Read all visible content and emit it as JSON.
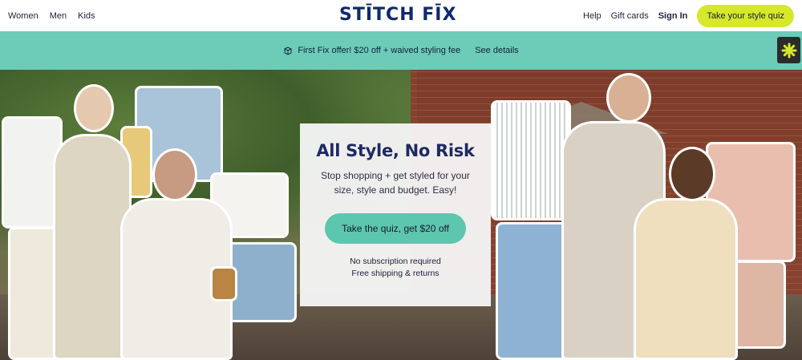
{
  "header": {
    "nav_left": [
      "Women",
      "Men",
      "Kids"
    ],
    "logo": "STĪTCH FĪX",
    "nav_right": {
      "help": "Help",
      "gift_cards": "Gift cards",
      "sign_in": "Sign In"
    },
    "quiz_button": "Take your style quiz"
  },
  "promo": {
    "icon": "gift-box-icon",
    "text": "First Fix offer! $20 off + waived styling fee",
    "details_link": "See details"
  },
  "chat": {
    "icon": "asterisk-chat-icon"
  },
  "hero": {
    "title": "All Style, No Risk",
    "subtitle": "Stop shopping + get styled for your size, style and budget. Easy!",
    "cta": "Take the quiz, get $20 off",
    "notes": [
      "No subscription required",
      "Free shipping & returns"
    ]
  },
  "colors": {
    "accent_lime": "#d6e82a",
    "promo_teal": "#6cccb8",
    "cta_teal": "#5dc6ae",
    "logo_navy": "#0e2a6b"
  }
}
